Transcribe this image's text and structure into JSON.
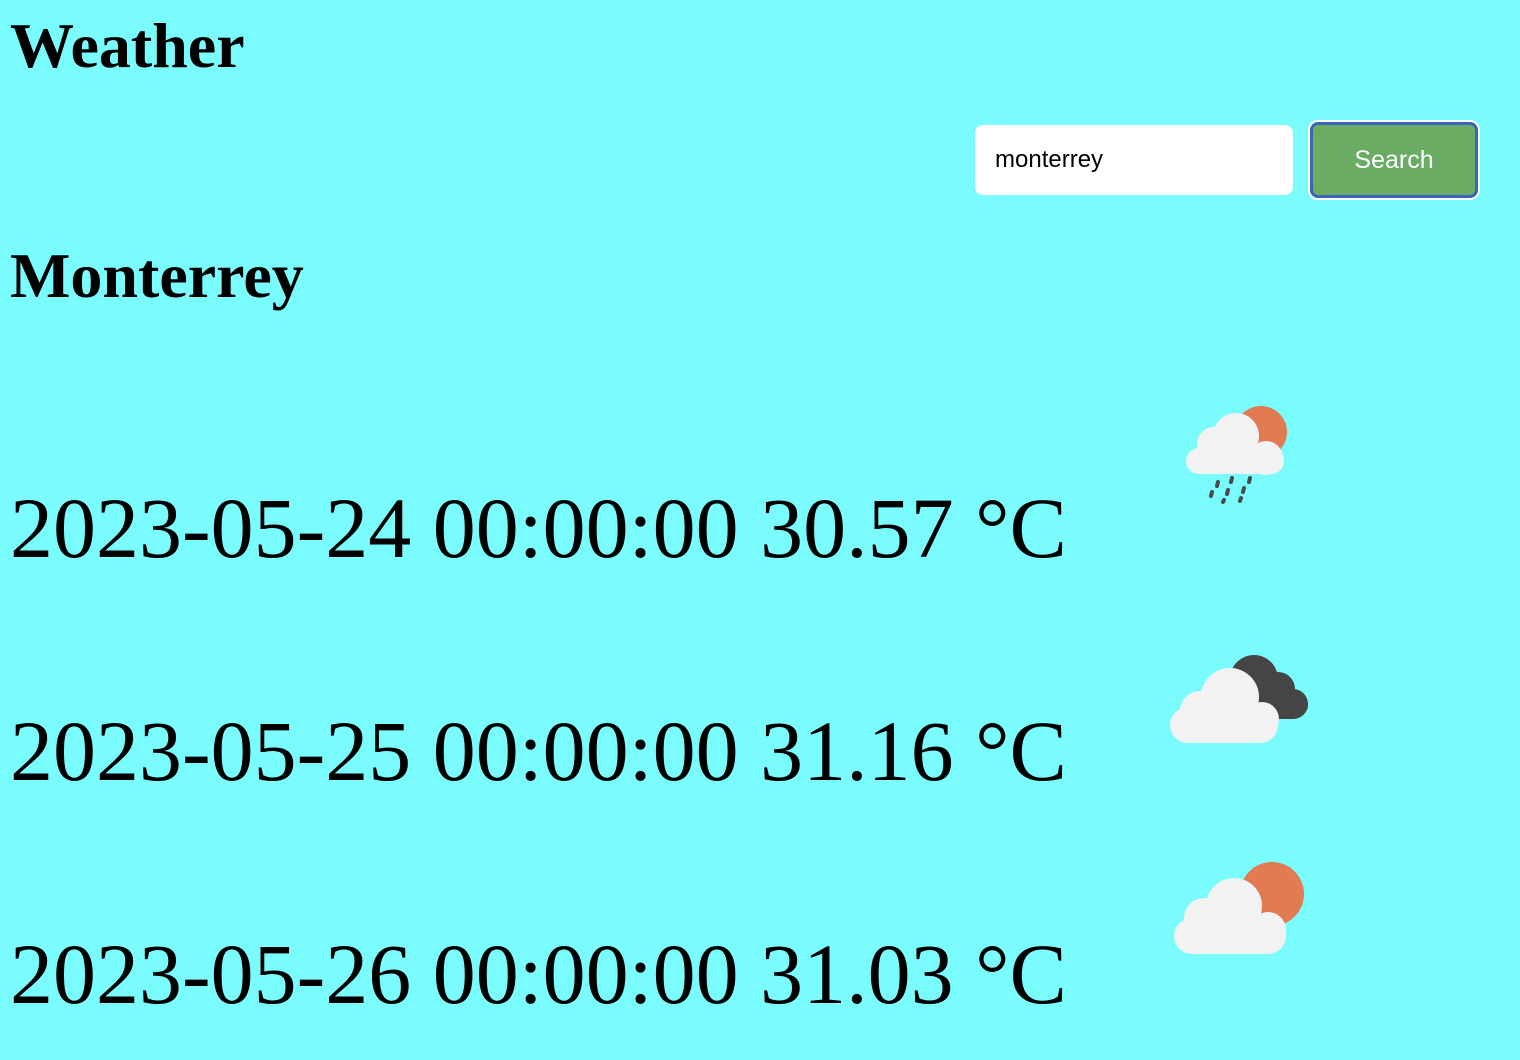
{
  "app": {
    "title": "Weather"
  },
  "search": {
    "value": "monterrey",
    "button_label": "Search"
  },
  "city": {
    "name": "Monterrey"
  },
  "forecast": [
    {
      "date": "2023-05-24 00:00:00",
      "temperature": "30.57 °C",
      "text": "2023-05-24 00:00:00 30.57 °C",
      "icon": "sun-cloud-rain-icon"
    },
    {
      "date": "2023-05-25 00:00:00",
      "temperature": "31.16 °C",
      "text": "2023-05-25 00:00:00 31.16 °C",
      "icon": "dark-cloud-icon"
    },
    {
      "date": "2023-05-26 00:00:00",
      "temperature": "31.03 °C",
      "text": "2023-05-26 00:00:00 31.03 °C",
      "icon": "sun-cloud-icon"
    }
  ],
  "colors": {
    "background": "#7afcff",
    "button_bg": "#6aac63",
    "button_border": "#3c64b8",
    "sun": "#e07b52",
    "cloud": "#f2f2f2",
    "dark_cloud": "#454545"
  }
}
